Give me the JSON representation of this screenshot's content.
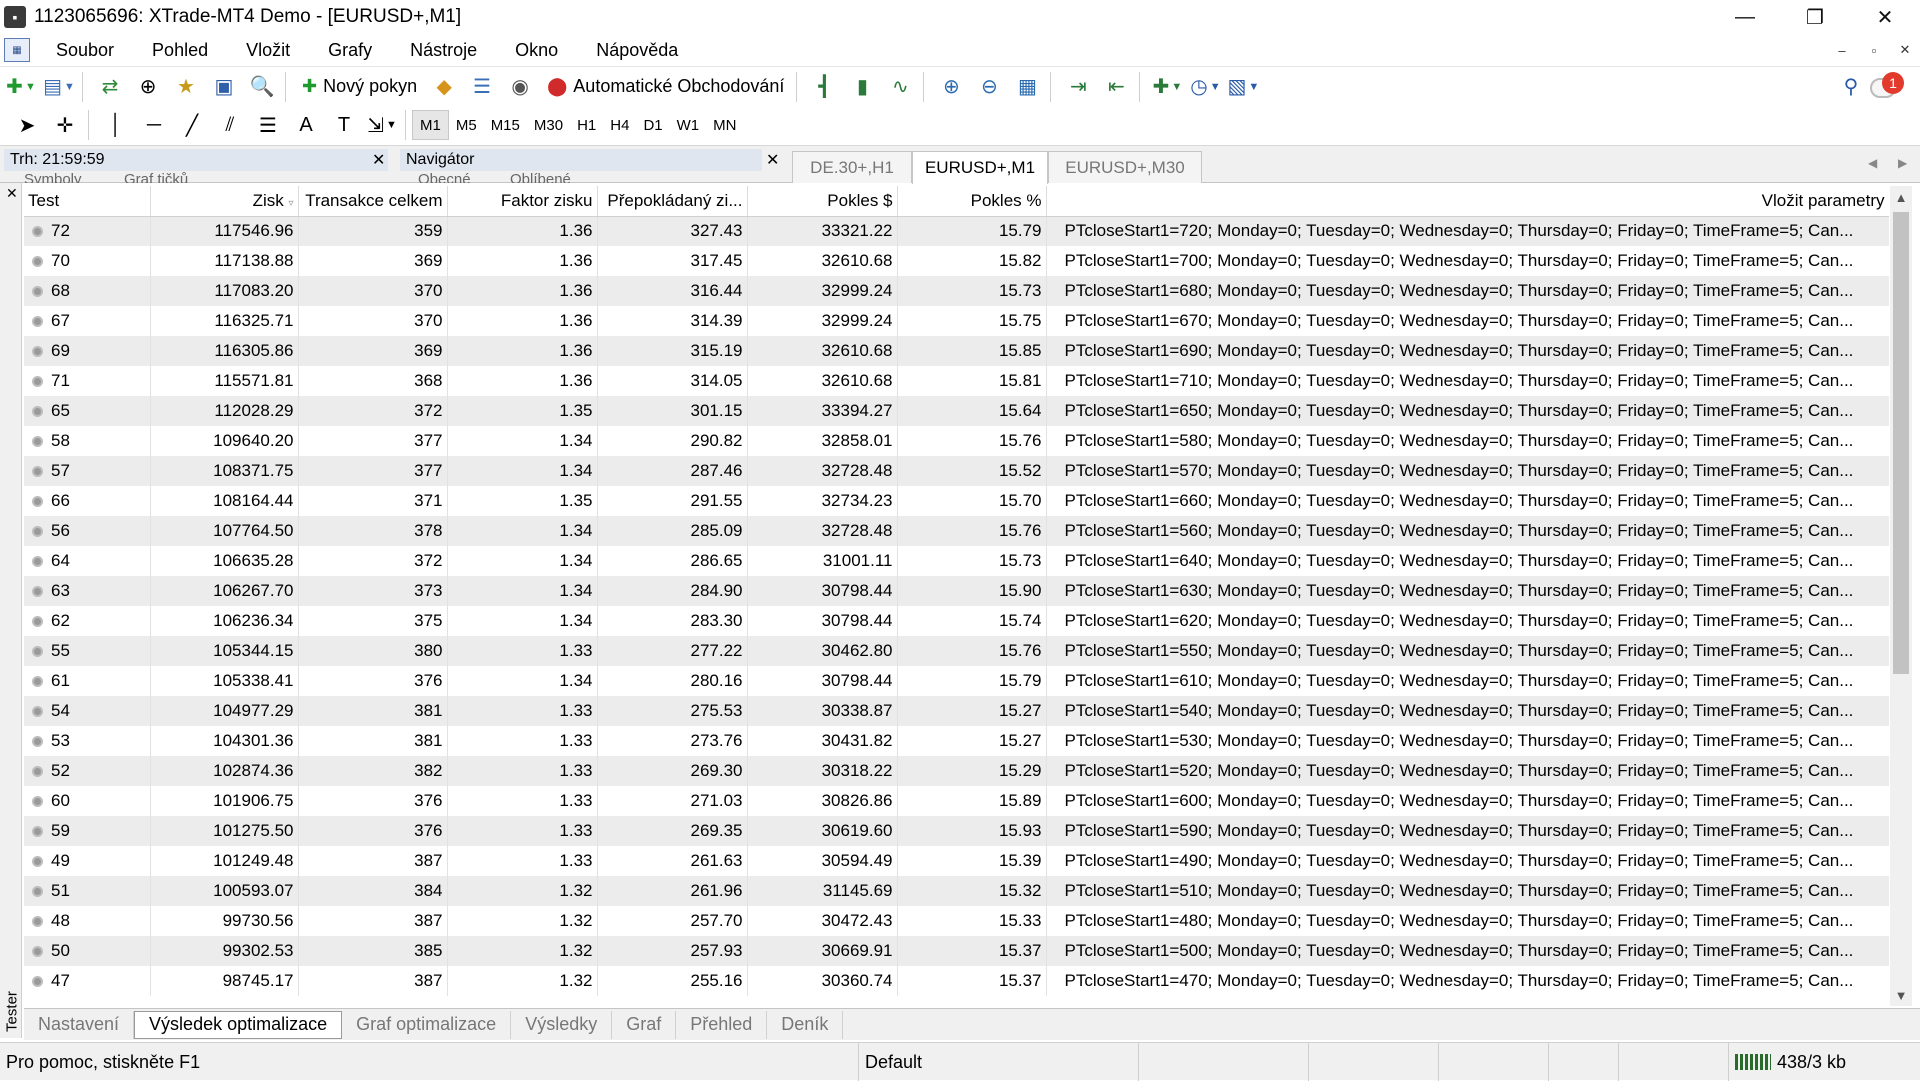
{
  "window": {
    "title": "1123065696: XTrade-MT4 Demo - [EURUSD+,M1]",
    "controls": [
      "—",
      "❐",
      "✕"
    ]
  },
  "menu": [
    "Soubor",
    "Pohled",
    "Vložit",
    "Grafy",
    "Nástroje",
    "Okno",
    "Nápověda"
  ],
  "toolbar": {
    "new_order": "Nový pokyn",
    "autotrading": "Automatické Obchodování",
    "notification_count": "1"
  },
  "timeframes": [
    "M1",
    "M5",
    "M15",
    "M30",
    "H1",
    "H4",
    "D1",
    "W1",
    "MN"
  ],
  "active_timeframe": "M1",
  "panels": {
    "market_watch": "Trh: 21:59:59",
    "market_watch_tabs": [
      "Symboly",
      "Graf tičků"
    ],
    "navigator": "Navigátor",
    "navigator_tabs": [
      "Obecné",
      "Oblíbené"
    ]
  },
  "chart_tabs": [
    "DE.30+,H1",
    "EURUSD+,M1",
    "EURUSD+,M30"
  ],
  "active_chart_tab": "EURUSD+,M1",
  "table": {
    "headers": {
      "test": "Test",
      "profit": "Zisk",
      "trades": "Transakce celkem",
      "profit_factor": "Faktor zisku",
      "expected_payoff": "Přepokládaný zi...",
      "drawdown": "Pokles $",
      "drawdown_pct": "Pokles %",
      "params": "Vložit parametry"
    },
    "rows": [
      [
        "72",
        "117546.96",
        "359",
        "1.36",
        "327.43",
        "33321.22",
        "15.79",
        "PTcloseStart1=720; Monday=0; Tuesday=0; Wednesday=0; Thursday=0; Friday=0; TimeFrame=5; Can..."
      ],
      [
        "70",
        "117138.88",
        "369",
        "1.36",
        "317.45",
        "32610.68",
        "15.82",
        "PTcloseStart1=700; Monday=0; Tuesday=0; Wednesday=0; Thursday=0; Friday=0; TimeFrame=5; Can..."
      ],
      [
        "68",
        "117083.20",
        "370",
        "1.36",
        "316.44",
        "32999.24",
        "15.73",
        "PTcloseStart1=680; Monday=0; Tuesday=0; Wednesday=0; Thursday=0; Friday=0; TimeFrame=5; Can..."
      ],
      [
        "67",
        "116325.71",
        "370",
        "1.36",
        "314.39",
        "32999.24",
        "15.75",
        "PTcloseStart1=670; Monday=0; Tuesday=0; Wednesday=0; Thursday=0; Friday=0; TimeFrame=5; Can..."
      ],
      [
        "69",
        "116305.86",
        "369",
        "1.36",
        "315.19",
        "32610.68",
        "15.85",
        "PTcloseStart1=690; Monday=0; Tuesday=0; Wednesday=0; Thursday=0; Friday=0; TimeFrame=5; Can..."
      ],
      [
        "71",
        "115571.81",
        "368",
        "1.36",
        "314.05",
        "32610.68",
        "15.81",
        "PTcloseStart1=710; Monday=0; Tuesday=0; Wednesday=0; Thursday=0; Friday=0; TimeFrame=5; Can..."
      ],
      [
        "65",
        "112028.29",
        "372",
        "1.35",
        "301.15",
        "33394.27",
        "15.64",
        "PTcloseStart1=650; Monday=0; Tuesday=0; Wednesday=0; Thursday=0; Friday=0; TimeFrame=5; Can..."
      ],
      [
        "58",
        "109640.20",
        "377",
        "1.34",
        "290.82",
        "32858.01",
        "15.76",
        "PTcloseStart1=580; Monday=0; Tuesday=0; Wednesday=0; Thursday=0; Friday=0; TimeFrame=5; Can..."
      ],
      [
        "57",
        "108371.75",
        "377",
        "1.34",
        "287.46",
        "32728.48",
        "15.52",
        "PTcloseStart1=570; Monday=0; Tuesday=0; Wednesday=0; Thursday=0; Friday=0; TimeFrame=5; Can..."
      ],
      [
        "66",
        "108164.44",
        "371",
        "1.35",
        "291.55",
        "32734.23",
        "15.70",
        "PTcloseStart1=660; Monday=0; Tuesday=0; Wednesday=0; Thursday=0; Friday=0; TimeFrame=5; Can..."
      ],
      [
        "56",
        "107764.50",
        "378",
        "1.34",
        "285.09",
        "32728.48",
        "15.76",
        "PTcloseStart1=560; Monday=0; Tuesday=0; Wednesday=0; Thursday=0; Friday=0; TimeFrame=5; Can..."
      ],
      [
        "64",
        "106635.28",
        "372",
        "1.34",
        "286.65",
        "31001.11",
        "15.73",
        "PTcloseStart1=640; Monday=0; Tuesday=0; Wednesday=0; Thursday=0; Friday=0; TimeFrame=5; Can..."
      ],
      [
        "63",
        "106267.70",
        "373",
        "1.34",
        "284.90",
        "30798.44",
        "15.90",
        "PTcloseStart1=630; Monday=0; Tuesday=0; Wednesday=0; Thursday=0; Friday=0; TimeFrame=5; Can..."
      ],
      [
        "62",
        "106236.34",
        "375",
        "1.34",
        "283.30",
        "30798.44",
        "15.74",
        "PTcloseStart1=620; Monday=0; Tuesday=0; Wednesday=0; Thursday=0; Friday=0; TimeFrame=5; Can..."
      ],
      [
        "55",
        "105344.15",
        "380",
        "1.33",
        "277.22",
        "30462.80",
        "15.76",
        "PTcloseStart1=550; Monday=0; Tuesday=0; Wednesday=0; Thursday=0; Friday=0; TimeFrame=5; Can..."
      ],
      [
        "61",
        "105338.41",
        "376",
        "1.34",
        "280.16",
        "30798.44",
        "15.79",
        "PTcloseStart1=610; Monday=0; Tuesday=0; Wednesday=0; Thursday=0; Friday=0; TimeFrame=5; Can..."
      ],
      [
        "54",
        "104977.29",
        "381",
        "1.33",
        "275.53",
        "30338.87",
        "15.27",
        "PTcloseStart1=540; Monday=0; Tuesday=0; Wednesday=0; Thursday=0; Friday=0; TimeFrame=5; Can..."
      ],
      [
        "53",
        "104301.36",
        "381",
        "1.33",
        "273.76",
        "30431.82",
        "15.27",
        "PTcloseStart1=530; Monday=0; Tuesday=0; Wednesday=0; Thursday=0; Friday=0; TimeFrame=5; Can..."
      ],
      [
        "52",
        "102874.36",
        "382",
        "1.33",
        "269.30",
        "30318.22",
        "15.29",
        "PTcloseStart1=520; Monday=0; Tuesday=0; Wednesday=0; Thursday=0; Friday=0; TimeFrame=5; Can..."
      ],
      [
        "60",
        "101906.75",
        "376",
        "1.33",
        "271.03",
        "30826.86",
        "15.89",
        "PTcloseStart1=600; Monday=0; Tuesday=0; Wednesday=0; Thursday=0; Friday=0; TimeFrame=5; Can..."
      ],
      [
        "59",
        "101275.50",
        "376",
        "1.33",
        "269.35",
        "30619.60",
        "15.93",
        "PTcloseStart1=590; Monday=0; Tuesday=0; Wednesday=0; Thursday=0; Friday=0; TimeFrame=5; Can..."
      ],
      [
        "49",
        "101249.48",
        "387",
        "1.33",
        "261.63",
        "30594.49",
        "15.39",
        "PTcloseStart1=490; Monday=0; Tuesday=0; Wednesday=0; Thursday=0; Friday=0; TimeFrame=5; Can..."
      ],
      [
        "51",
        "100593.07",
        "384",
        "1.32",
        "261.96",
        "31145.69",
        "15.32",
        "PTcloseStart1=510; Monday=0; Tuesday=0; Wednesday=0; Thursday=0; Friday=0; TimeFrame=5; Can..."
      ],
      [
        "48",
        "99730.56",
        "387",
        "1.32",
        "257.70",
        "30472.43",
        "15.33",
        "PTcloseStart1=480; Monday=0; Tuesday=0; Wednesday=0; Thursday=0; Friday=0; TimeFrame=5; Can..."
      ],
      [
        "50",
        "99302.53",
        "385",
        "1.32",
        "257.93",
        "30669.91",
        "15.37",
        "PTcloseStart1=500; Monday=0; Tuesday=0; Wednesday=0; Thursday=0; Friday=0; TimeFrame=5; Can..."
      ],
      [
        "47",
        "98745.17",
        "387",
        "1.32",
        "255.16",
        "30360.74",
        "15.37",
        "PTcloseStart1=470; Monday=0; Tuesday=0; Wednesday=0; Thursday=0; Friday=0; TimeFrame=5; Can..."
      ]
    ]
  },
  "tester": {
    "label": "Tester",
    "tabs": [
      "Nastavení",
      "Výsledek optimalizace",
      "Graf optimalizace",
      "Výsledky",
      "Graf",
      "Přehled",
      "Deník"
    ],
    "active_tab": "Výsledek optimalizace"
  },
  "status": {
    "help": "Pro pomoc, stiskněte F1",
    "profile": "Default",
    "traffic": "438/3 kb"
  }
}
